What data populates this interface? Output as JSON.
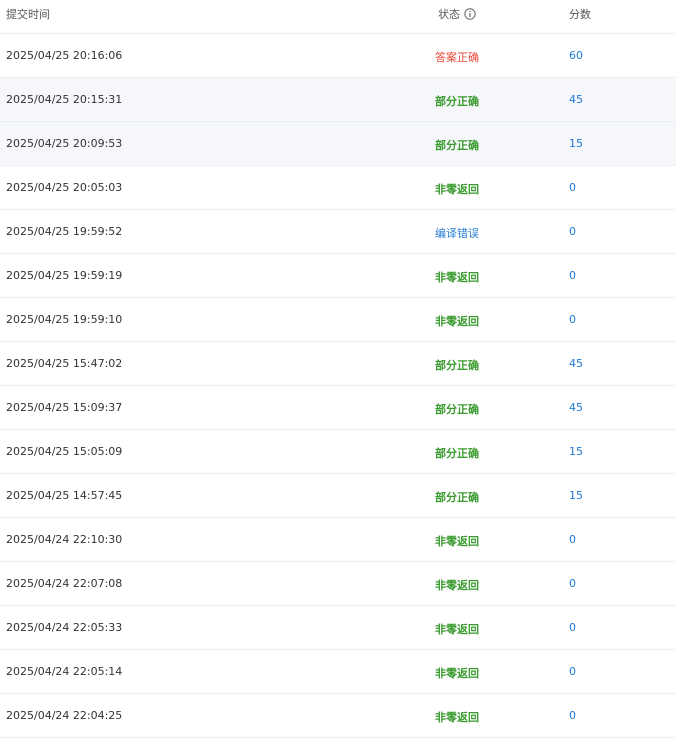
{
  "header": {
    "time_label": "提交时间",
    "status_label": "状态",
    "score_label": "分数",
    "status_info_icon": "info-circle-icon"
  },
  "colors": {
    "accepted": "#e8483d",
    "partial": "#3a9b2f",
    "nonzero": "#3a9b2f",
    "compile_error": "#2a7fd4",
    "score": "#1e7ad6"
  },
  "rows": [
    {
      "time": "2025/04/25 20:16:06",
      "status": "答案正确",
      "status_kind": "red",
      "score": "60"
    },
    {
      "time": "2025/04/25 20:15:31",
      "status": "部分正确",
      "status_kind": "green",
      "score": "45"
    },
    {
      "time": "2025/04/25 20:09:53",
      "status": "部分正确",
      "status_kind": "green",
      "score": "15"
    },
    {
      "time": "2025/04/25 20:05:03",
      "status": "非零返回",
      "status_kind": "green",
      "score": "0"
    },
    {
      "time": "2025/04/25 19:59:52",
      "status": "编译错误",
      "status_kind": "blue",
      "score": "0"
    },
    {
      "time": "2025/04/25 19:59:19",
      "status": "非零返回",
      "status_kind": "green",
      "score": "0"
    },
    {
      "time": "2025/04/25 19:59:10",
      "status": "非零返回",
      "status_kind": "green",
      "score": "0"
    },
    {
      "time": "2025/04/25 15:47:02",
      "status": "部分正确",
      "status_kind": "green",
      "score": "45"
    },
    {
      "time": "2025/04/25 15:09:37",
      "status": "部分正确",
      "status_kind": "green",
      "score": "45"
    },
    {
      "time": "2025/04/25 15:05:09",
      "status": "部分正确",
      "status_kind": "green",
      "score": "15"
    },
    {
      "time": "2025/04/25 14:57:45",
      "status": "部分正确",
      "status_kind": "green",
      "score": "15"
    },
    {
      "time": "2025/04/24 22:10:30",
      "status": "非零返回",
      "status_kind": "green",
      "score": "0"
    },
    {
      "time": "2025/04/24 22:07:08",
      "status": "非零返回",
      "status_kind": "green",
      "score": "0"
    },
    {
      "time": "2025/04/24 22:05:33",
      "status": "非零返回",
      "status_kind": "green",
      "score": "0"
    },
    {
      "time": "2025/04/24 22:05:14",
      "status": "非零返回",
      "status_kind": "green",
      "score": "0"
    },
    {
      "time": "2025/04/24 22:04:25",
      "status": "非零返回",
      "status_kind": "green",
      "score": "0"
    }
  ]
}
